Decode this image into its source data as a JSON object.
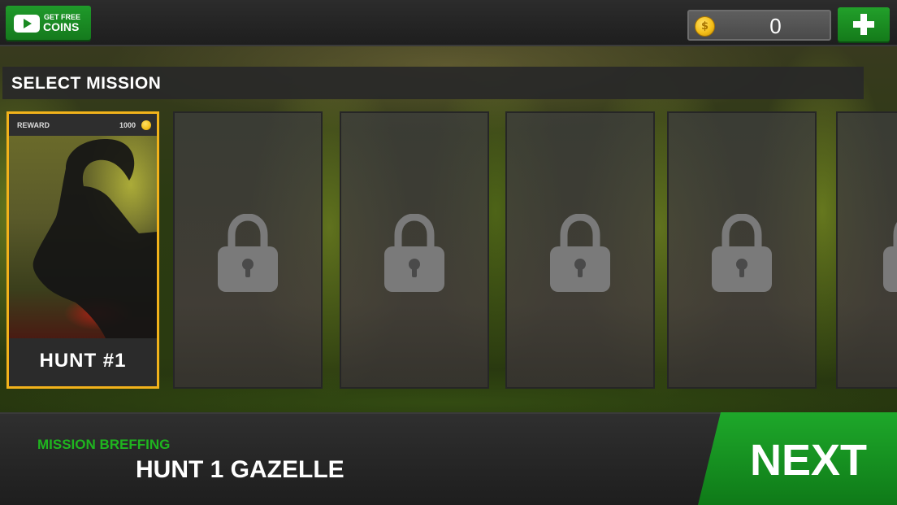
{
  "top_bar": {
    "free_coins_line1": "GET FREE",
    "free_coins_line2": "COINS",
    "coin_count": "0",
    "coin_symbol": "$"
  },
  "mission_header": "SELECT MISSION",
  "cards": [
    {
      "state": "unlocked",
      "reward_label": "REWARD",
      "reward_value": "1000",
      "name": "HUNT #1"
    },
    {
      "state": "locked"
    },
    {
      "state": "locked"
    },
    {
      "state": "locked"
    },
    {
      "state": "locked"
    },
    {
      "state": "locked"
    }
  ],
  "briefing": {
    "label": "MISSION BREFFING",
    "title": "HUNT 1 GAZELLE"
  },
  "next_label": "NEXT",
  "colors": {
    "accent_green": "#1fb51f",
    "selected_border": "#f2b21b",
    "coin_gold": "#f5c01a"
  },
  "icons": [
    "youtube-play-icon",
    "coin-icon",
    "plus-icon",
    "lock-icon",
    "ibex-silhouette"
  ]
}
